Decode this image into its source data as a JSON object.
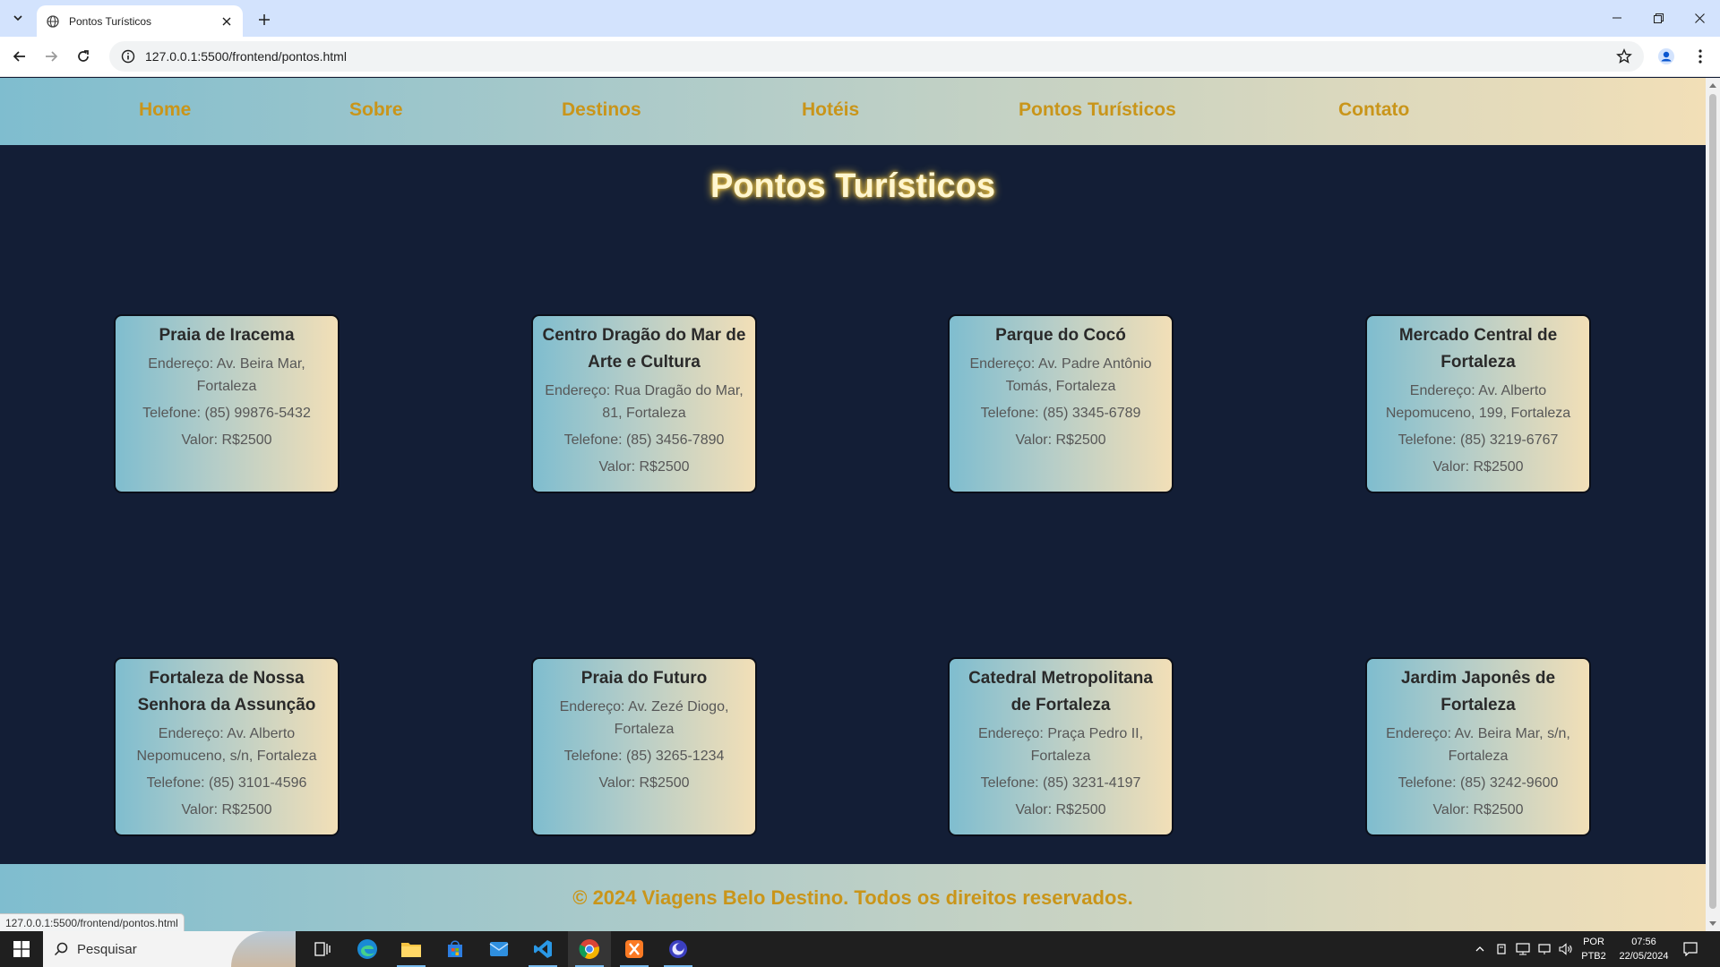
{
  "browser": {
    "tab_title": "Pontos Turísticos",
    "url": "127.0.0.1:5500/frontend/pontos.html",
    "status_url": "127.0.0.1:5500/frontend/pontos.html"
  },
  "nav": {
    "items": [
      "Home",
      "Sobre",
      "Destinos",
      "Hotéis",
      "Pontos Turísticos",
      "Contato"
    ]
  },
  "page": {
    "title": "Pontos Turísticos"
  },
  "cards": [
    {
      "name": "Praia de Iracema",
      "address": "Endereço: Av. Beira Mar, Fortaleza",
      "phone": "Telefone: (85) 99876-5432",
      "price": "Valor: R$2500"
    },
    {
      "name": "Centro Dragão do Mar de Arte e Cultura",
      "address": "Endereço: Rua Dragão do Mar, 81, Fortaleza",
      "phone": "Telefone: (85) 3456-7890",
      "price": "Valor: R$2500"
    },
    {
      "name": "Parque do Cocó",
      "address": "Endereço: Av. Padre Antônio Tomás, Fortaleza",
      "phone": "Telefone: (85) 3345-6789",
      "price": "Valor: R$2500"
    },
    {
      "name": "Mercado Central de Fortaleza",
      "address": "Endereço: Av. Alberto Nepomuceno, 199, Fortaleza",
      "phone": "Telefone: (85) 3219-6767",
      "price": "Valor: R$2500"
    },
    {
      "name": "Fortaleza de Nossa Senhora da Assunção",
      "address": "Endereço: Av. Alberto Nepomuceno, s/n, Fortaleza",
      "phone": "Telefone: (85) 3101-4596",
      "price": "Valor: R$2500"
    },
    {
      "name": "Praia do Futuro",
      "address": "Endereço: Av. Zezé Diogo, Fortaleza",
      "phone": "Telefone: (85) 3265-1234",
      "price": "Valor: R$2500"
    },
    {
      "name": "Catedral Metropolitana de Fortaleza",
      "address": "Endereço: Praça Pedro II, Fortaleza",
      "phone": "Telefone: (85) 3231-4197",
      "price": "Valor: R$2500"
    },
    {
      "name": "Jardim Japonês de Fortaleza",
      "address": "Endereço: Av. Beira Mar, s/n, Fortaleza",
      "phone": "Telefone: (85) 3242-9600",
      "price": "Valor: R$2500"
    }
  ],
  "footer": {
    "text": "© 2024 Viagens Belo Destino. Todos os direitos reservados."
  },
  "taskbar": {
    "search_label": "Pesquisar",
    "lang_line1": "POR",
    "lang_line2": "PTB2",
    "time": "07:56",
    "date": "22/05/2024"
  },
  "colors": {
    "page_bg": "#131e36",
    "nav_link": "#c9951a",
    "gradient_start": "#7fbdcf",
    "gradient_end": "#f2dfb7",
    "title_glow": "#ffd24a"
  },
  "icons": {
    "tab_search": "chevron-down-icon",
    "favicon": "globe-icon",
    "close": "close-icon",
    "new_tab": "plus-icon",
    "back": "arrow-left-icon",
    "forward": "arrow-right-icon",
    "reload": "reload-icon",
    "site_info": "info-icon",
    "bookmark": "star-icon",
    "profile": "person-icon",
    "menu": "kebab-menu-icon"
  }
}
